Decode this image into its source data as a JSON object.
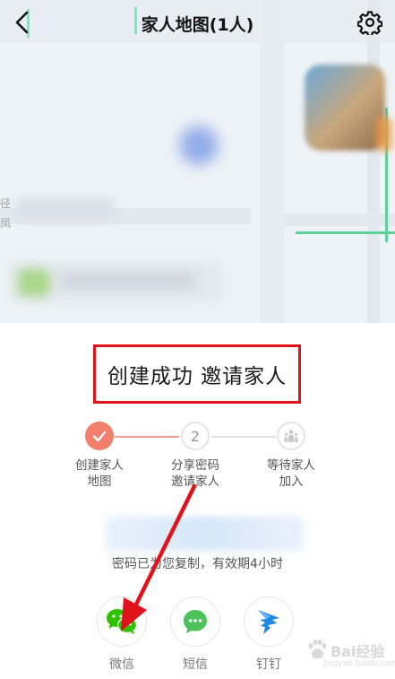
{
  "header": {
    "title": "家人地图(1人)",
    "back_icon": "chevron-left-icon",
    "settings_icon": "gear-icon"
  },
  "map": {
    "edge_label_1": "径",
    "edge_label_2": "凤"
  },
  "panel": {
    "headline": "创建成功 邀请家人",
    "steps": [
      {
        "label": "创建家人\n地图",
        "state": "done",
        "icon": "checkmark-icon"
      },
      {
        "label": "分享密码\n邀请家人",
        "state": "current",
        "number": "2"
      },
      {
        "label": "等待家人\n加入",
        "state": "pending",
        "icon": "family-icon"
      }
    ],
    "copy_note": "密码已为您复制，有效期4小时",
    "share": [
      {
        "label": "微信",
        "icon": "wechat-icon"
      },
      {
        "label": "短信",
        "icon": "sms-icon"
      },
      {
        "label": "钉钉",
        "icon": "dingtalk-icon"
      }
    ]
  },
  "watermark": {
    "text": "Bai经验",
    "url": "jingyan.baidu.com"
  },
  "colors": {
    "annotation_red": "#e0131b",
    "step_done": "#f27f6c",
    "wechat_green": "#2dc100",
    "dingtalk_blue": "#1e88e5"
  }
}
